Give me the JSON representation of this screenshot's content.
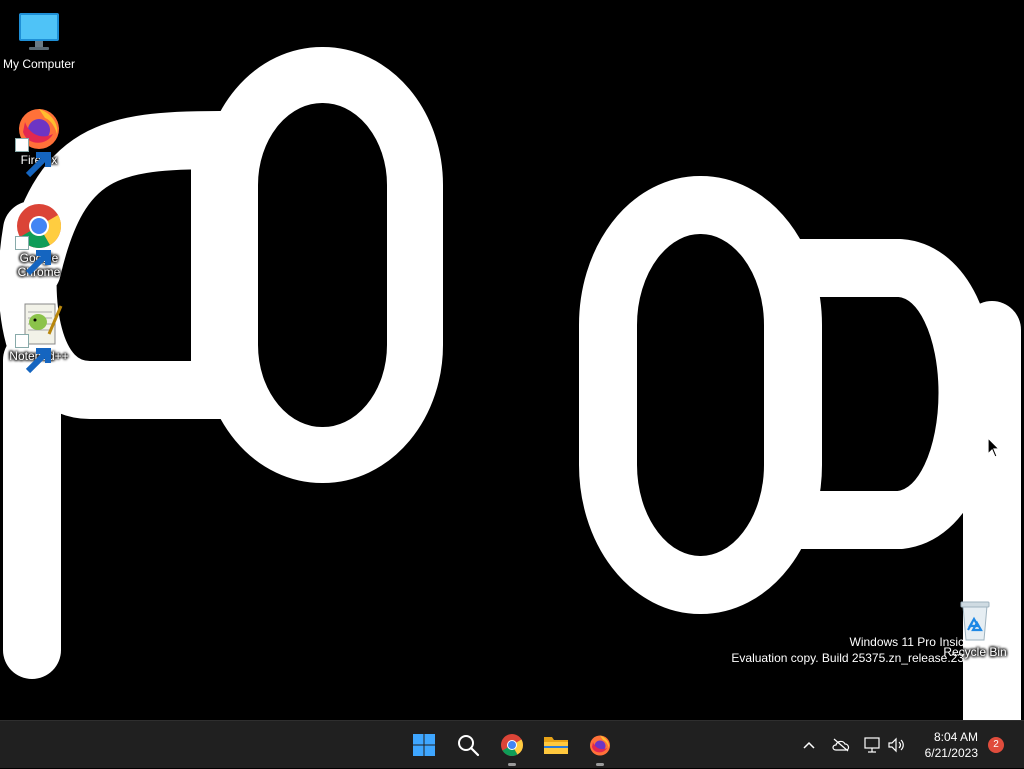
{
  "desktop": {
    "icons": [
      {
        "label": "My Computer",
        "icon": "monitor-icon"
      },
      {
        "label": "Firefox",
        "icon": "firefox-icon",
        "shortcut": true
      },
      {
        "label": "Google Chrome",
        "icon": "chrome-icon",
        "shortcut": true
      },
      {
        "label": "Notepad++",
        "icon": "notepadpp-icon",
        "shortcut": true
      },
      {
        "label": "Recycle Bin",
        "icon": "recycle-bin-icon"
      }
    ]
  },
  "watermark": {
    "line1": "Windows 11 Pro Insic",
    "line2": "Evaluation copy. Build 25375.zn_release.23"
  },
  "taskbar": {
    "pinned": [
      "start-icon",
      "search-icon",
      "chrome-icon",
      "file-explorer-icon",
      "firefox-icon"
    ],
    "tray_icons": [
      "chevron-up-icon",
      "onedrive-offline-icon",
      "network-icon",
      "volume-icon"
    ],
    "time": "8:04 AM",
    "date": "6/21/2023",
    "notification_count": "2"
  },
  "colors": {
    "taskbar_bg": "#202020",
    "badge": "#e04c3c",
    "wallpaper": "#000000",
    "strokes": "#ffffff"
  }
}
